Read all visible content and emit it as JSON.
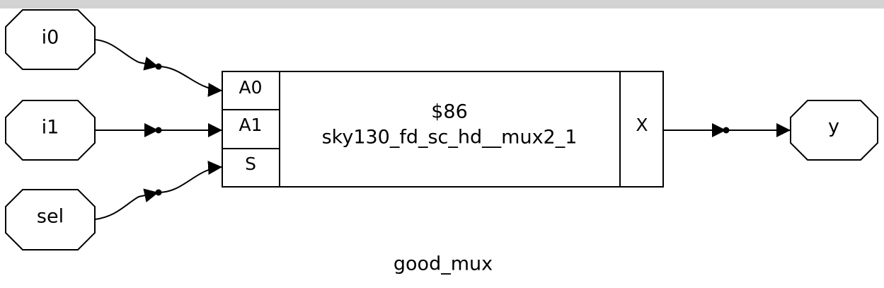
{
  "diagram": {
    "inputs": [
      "i0",
      "i1",
      "sel"
    ],
    "output": "y",
    "cell": {
      "id": "$86",
      "type": "sky130_fd_sc_hd__mux2_1",
      "pins": {
        "a0": "A0",
        "a1": "A1",
        "s": "S",
        "x": "X"
      }
    },
    "module": "good_mux"
  },
  "colors": {
    "background": "#d3d3d3",
    "canvas": "#ffffff",
    "stroke": "#000000"
  }
}
